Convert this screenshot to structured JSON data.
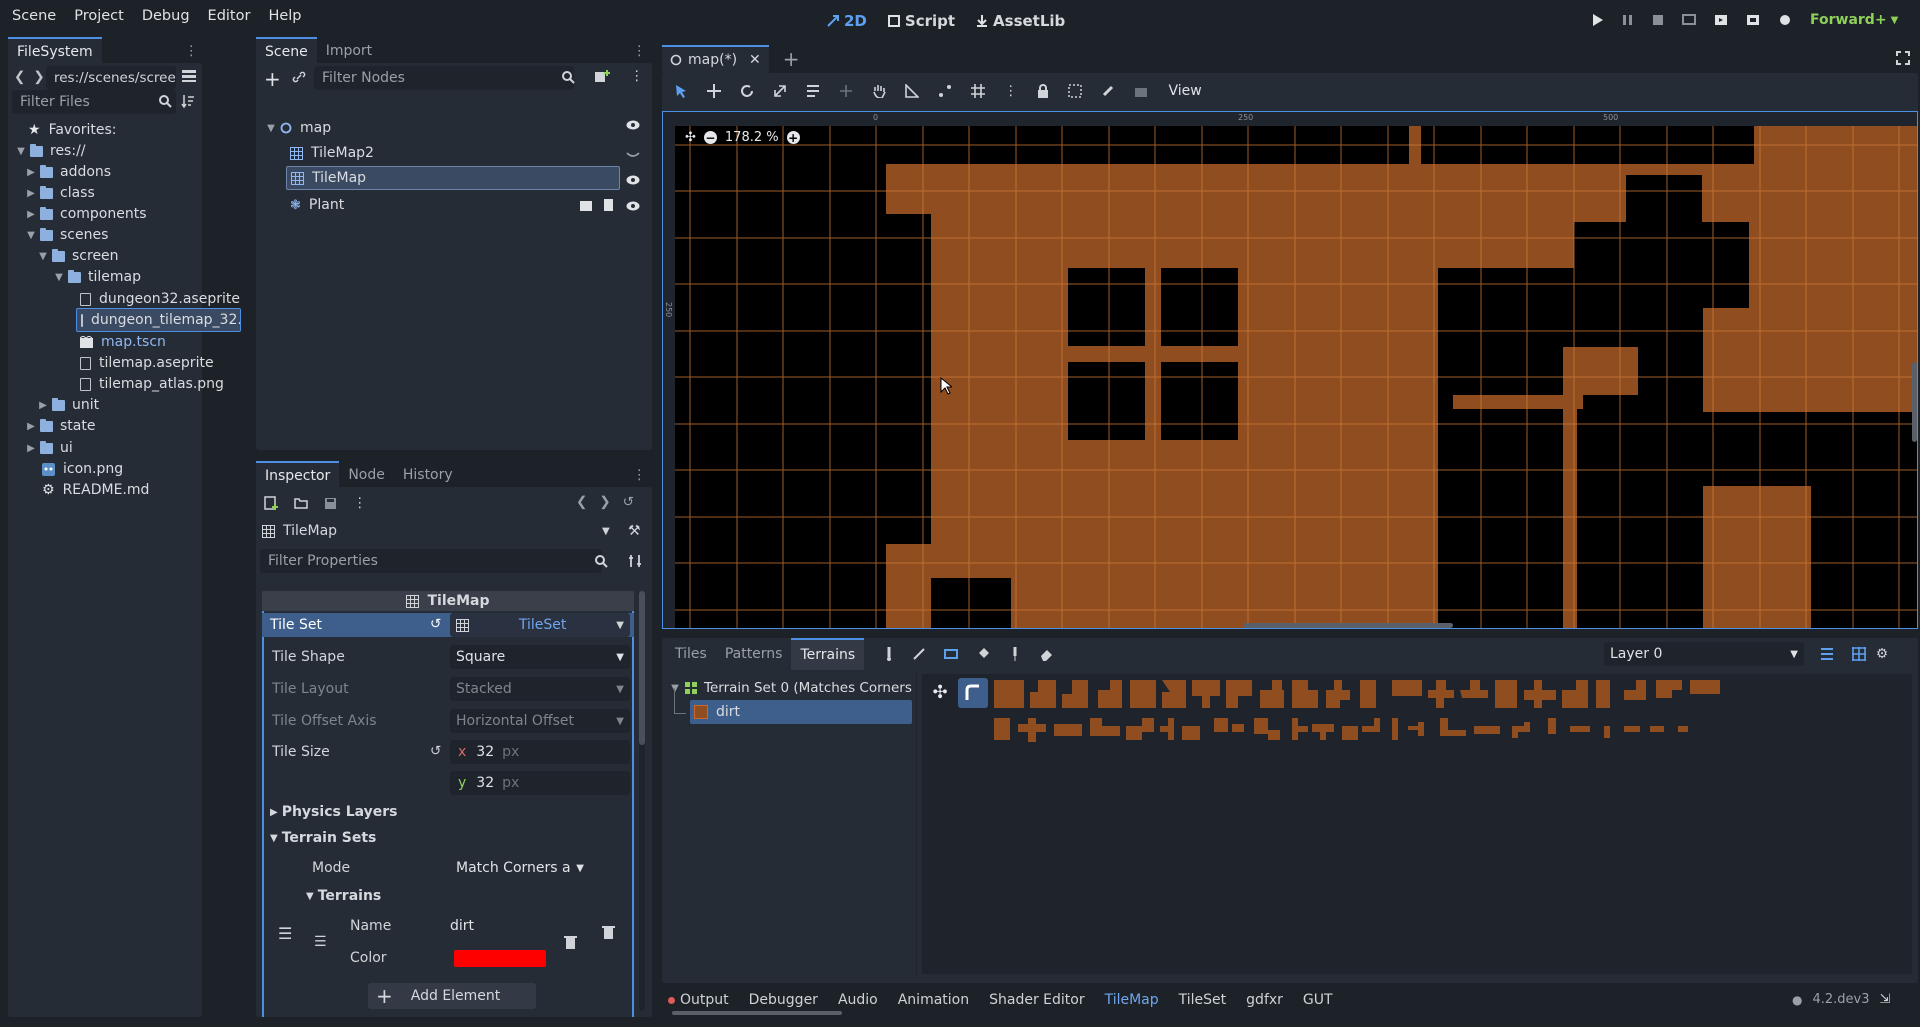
{
  "menubar": {
    "items": [
      "Scene",
      "Project",
      "Debug",
      "Editor",
      "Help"
    ],
    "workspaces": {
      "twod": "2D",
      "script": "Script",
      "assetlib": "AssetLib"
    },
    "renderer": "Forward+"
  },
  "filesystem": {
    "tab": "FileSystem",
    "path": "res://scenes/screen/til",
    "filter_placeholder": "Filter Files",
    "favorites": "Favorites:",
    "root": "res://",
    "items": {
      "addons": "addons",
      "class": "class",
      "components": "components",
      "scenes": "scenes",
      "screen": "screen",
      "tilemap": "tilemap",
      "dungeon32": "dungeon32.aseprite",
      "dungeon_tilemap": "dungeon_tilemap_32.",
      "map_tscn": "map.tscn",
      "tilemap_aseprite": "tilemap.aseprite",
      "tilemap_atlas": "tilemap_atlas.png",
      "unit": "unit",
      "state": "state",
      "ui": "ui",
      "icon": "icon.png",
      "readme": "README.md"
    }
  },
  "scene_dock": {
    "tabs": [
      "Scene",
      "Import"
    ],
    "filter_placeholder": "Filter Nodes",
    "nodes": {
      "root": "map",
      "tilemap2": "TileMap2",
      "tilemap": "TileMap",
      "plant": "Plant"
    }
  },
  "inspector": {
    "tabs": [
      "Inspector",
      "Node",
      "History"
    ],
    "object": "TileMap",
    "filter_placeholder": "Filter Properties",
    "section": "TileMap",
    "tile_set_label": "Tile Set",
    "tile_set_value": "TileSet",
    "tile_shape_label": "Tile Shape",
    "tile_shape_value": "Square",
    "tile_layout_label": "Tile Layout",
    "tile_layout_value": "Stacked",
    "tile_offset_label": "Tile Offset Axis",
    "tile_offset_value": "Horizontal Offset",
    "tile_size_label": "Tile Size",
    "tile_size_x_label": "x",
    "tile_size_x": "32",
    "tile_size_y_label": "y",
    "tile_size_y": "32",
    "unit": "px",
    "physics_layers": "Physics Layers",
    "terrain_sets": "Terrain Sets",
    "mode_label": "Mode",
    "mode_value": "Match Corners a",
    "terrains": "Terrains",
    "name_label": "Name",
    "name_value": "dirt",
    "color_label": "Color",
    "color_value": "#ff0000",
    "add_element": "Add Element"
  },
  "viewport": {
    "tab_title": "map(*)",
    "view_menu": "View",
    "zoom": "178.2 %",
    "ruler_marks": [
      "0",
      "250",
      "500"
    ],
    "ruler_vertical": "250"
  },
  "tilemap_panel": {
    "tabs": [
      "Tiles",
      "Patterns",
      "Terrains"
    ],
    "layer": "Layer 0",
    "terrain_set": "Terrain Set 0 (Matches Corners",
    "terrain_item": "dirt"
  },
  "bottom_bar": {
    "tabs": [
      "Output",
      "Debugger",
      "Audio",
      "Animation",
      "Shader Editor",
      "TileMap",
      "TileSet",
      "gdfxr",
      "GUT"
    ],
    "version": "4.2.dev3"
  },
  "colors": {
    "accent": "#4e8fe6",
    "dirt": "#8f4d20",
    "terrain_color": "#ff0000"
  }
}
